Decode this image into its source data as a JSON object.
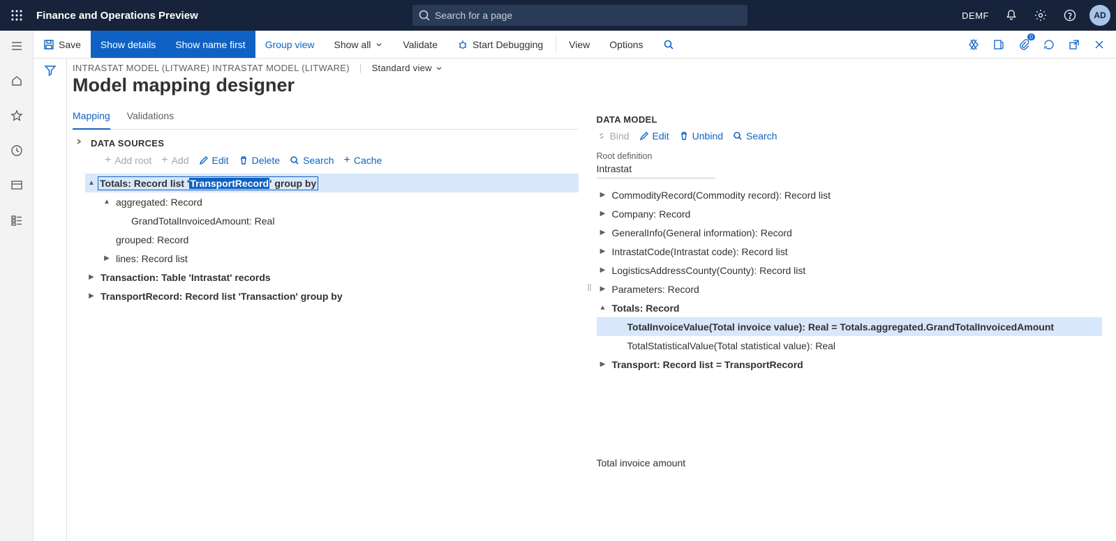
{
  "topbar": {
    "title": "Finance and Operations Preview",
    "search_placeholder": "Search for a page",
    "company": "DEMF",
    "avatar": "AD"
  },
  "cmdbar": {
    "save": "Save",
    "show_details": "Show details",
    "show_name_first": "Show name first",
    "group_view": "Group view",
    "show_all": "Show all",
    "validate": "Validate",
    "start_debugging": "Start Debugging",
    "view": "View",
    "options": "Options",
    "attach_badge": "0"
  },
  "breadcrumb": {
    "path": "INTRASTAT MODEL (LITWARE) INTRASTAT MODEL (LITWARE)",
    "view": "Standard view"
  },
  "page_title": "Model mapping designer",
  "tabs": {
    "mapping": "Mapping",
    "validations": "Validations"
  },
  "ds": {
    "title": "DATA SOURCES",
    "btn_add_root": "Add root",
    "btn_add": "Add",
    "btn_edit": "Edit",
    "btn_delete": "Delete",
    "btn_search": "Search",
    "btn_cache": "Cache",
    "tree": {
      "totals_pre": "Totals: Record list '",
      "totals_hl": "TransportRecord",
      "totals_post": "' group by",
      "aggregated": "aggregated: Record",
      "grandtotal": "GrandTotalInvoicedAmount: Real",
      "grouped": "grouped: Record",
      "lines": "lines: Record list",
      "transaction": "Transaction: Table 'Intrastat' records",
      "transportrecord": "TransportRecord: Record list 'Transaction' group by"
    }
  },
  "dm": {
    "title": "DATA MODEL",
    "btn_bind": "Bind",
    "btn_edit": "Edit",
    "btn_unbind": "Unbind",
    "btn_search": "Search",
    "rootdef_label": "Root definition",
    "rootdef_value": "Intrastat",
    "tree": {
      "commodity": "CommodityRecord(Commodity record): Record list",
      "company": "Company: Record",
      "general": "GeneralInfo(General information): Record",
      "intracode": "IntrastatCode(Intrastat code): Record list",
      "logistics": "LogisticsAddressCounty(County): Record list",
      "parameters": "Parameters: Record",
      "totals": "Totals: Record",
      "total_invoice": "TotalInvoiceValue(Total invoice value): Real = Totals.aggregated.GrandTotalInvoicedAmount",
      "total_stat": "TotalStatisticalValue(Total statistical value): Real",
      "transport": "Transport: Record list = TransportRecord"
    },
    "bottom_note": "Total invoice amount"
  }
}
